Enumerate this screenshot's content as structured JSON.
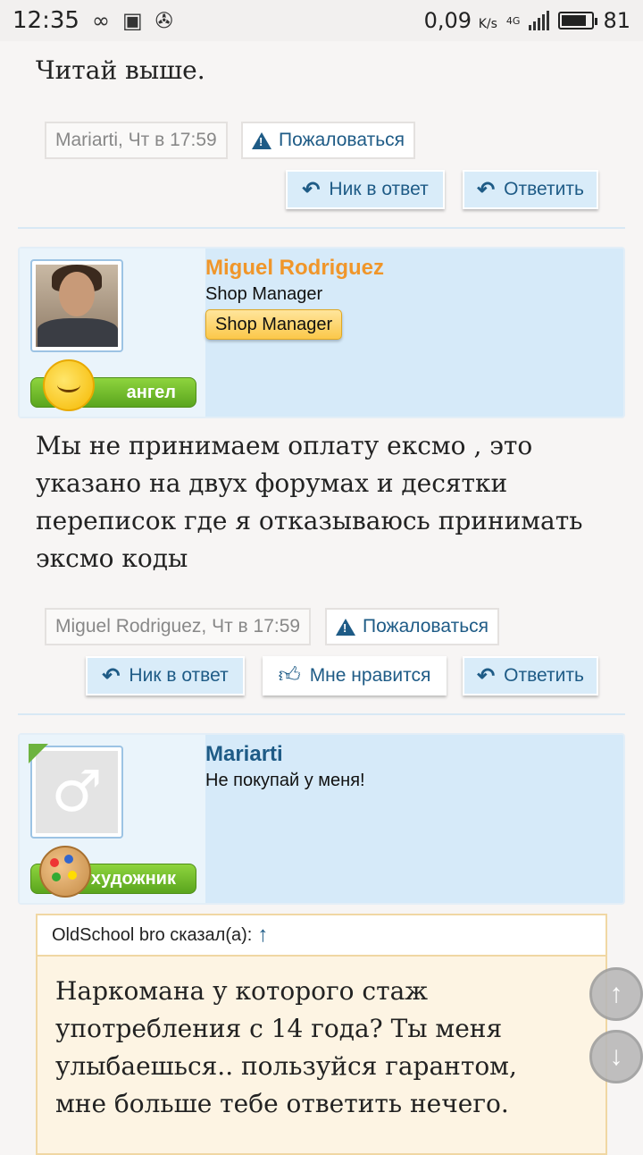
{
  "status_bar": {
    "time": "12:35",
    "speed": "0,09",
    "speed_unit": "K/s",
    "network": "4G",
    "battery": "81"
  },
  "posts": [
    {
      "text": "Читай выше.",
      "meta": {
        "author": "Mariarti",
        "time": ", Чт в 17:59"
      },
      "report_label": "Пожаловаться",
      "buttons": {
        "nick_reply": "Ник в ответ",
        "reply": "Ответить"
      }
    },
    {
      "author": {
        "name": "Miguel Rodriguez",
        "name_color": "#f0962a",
        "title": "Shop Manager",
        "role_badge": "Shop Manager",
        "rank_label": "ангел"
      },
      "text_lines": [
        "Мы не принимаем оплату ексмо , это",
        "указано на двух форумах и десятки",
        "переписок где я отказываюсь принимать",
        "эксмо коды"
      ],
      "meta": {
        "author": "Miguel Rodriguez",
        "time": ", Чт в 17:59"
      },
      "report_label": "Пожаловаться",
      "buttons": {
        "nick_reply": "Ник в ответ",
        "like": "Мне нравится",
        "reply": "Ответить"
      }
    },
    {
      "author": {
        "name": "Mariarti",
        "name_color": "#1e5b86",
        "title": "Не покупай у меня!",
        "rank_label": "художник"
      },
      "quote": {
        "header": "OldSchool bro сказал(а):",
        "arrow": "↑",
        "text_lines": [
          "Наркомана у которого стаж",
          "употребления с 14 года? Ты меня",
          "улыбаешься.. пользуйся гарантом,",
          "мне больше тебе ответить нечего."
        ]
      }
    }
  ],
  "scroll": {
    "up": "↑",
    "down": "↓"
  }
}
